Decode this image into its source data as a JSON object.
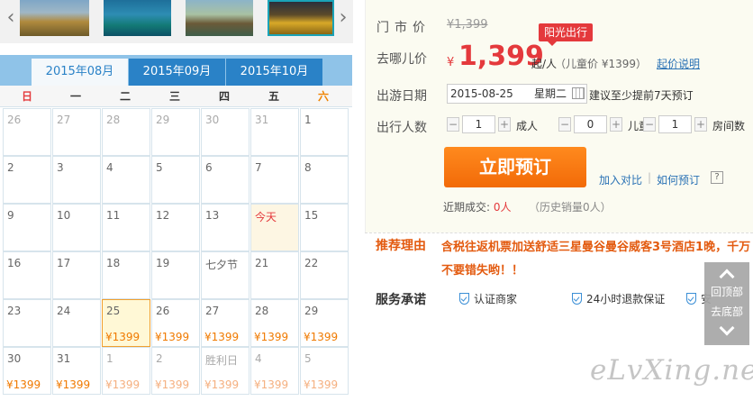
{
  "thumbnails": [
    "thumb-1",
    "thumb-2",
    "thumb-3",
    "thumb-4"
  ],
  "calendar": {
    "tabs": [
      {
        "label": "2015年08月",
        "active": true
      },
      {
        "label": "2015年09月",
        "active": false
      },
      {
        "label": "2015年10月",
        "active": false
      }
    ],
    "weekdays": [
      "日",
      "一",
      "二",
      "三",
      "四",
      "五",
      "六"
    ],
    "rows": [
      [
        {
          "d": "26",
          "m": true,
          "p": ""
        },
        {
          "d": "27",
          "m": true,
          "p": ""
        },
        {
          "d": "28",
          "m": true,
          "p": ""
        },
        {
          "d": "29",
          "m": true,
          "p": ""
        },
        {
          "d": "30",
          "m": true,
          "p": ""
        },
        {
          "d": "31",
          "m": true,
          "p": ""
        },
        {
          "d": "1",
          "m": false,
          "p": ""
        }
      ],
      [
        {
          "d": "2",
          "m": false,
          "p": ""
        },
        {
          "d": "3",
          "m": false,
          "p": ""
        },
        {
          "d": "4",
          "m": false,
          "p": ""
        },
        {
          "d": "5",
          "m": false,
          "p": ""
        },
        {
          "d": "6",
          "m": false,
          "p": ""
        },
        {
          "d": "7",
          "m": false,
          "p": ""
        },
        {
          "d": "8",
          "m": false,
          "p": ""
        }
      ],
      [
        {
          "d": "9",
          "m": false,
          "p": ""
        },
        {
          "d": "10",
          "m": false,
          "p": ""
        },
        {
          "d": "11",
          "m": false,
          "p": ""
        },
        {
          "d": "12",
          "m": false,
          "p": ""
        },
        {
          "d": "13",
          "m": false,
          "p": ""
        },
        {
          "d": "今天",
          "m": false,
          "p": "",
          "today": true
        },
        {
          "d": "15",
          "m": false,
          "p": ""
        }
      ],
      [
        {
          "d": "16",
          "m": false,
          "p": ""
        },
        {
          "d": "17",
          "m": false,
          "p": ""
        },
        {
          "d": "18",
          "m": false,
          "p": ""
        },
        {
          "d": "19",
          "m": false,
          "p": ""
        },
        {
          "d": "七夕节",
          "m": false,
          "p": ""
        },
        {
          "d": "21",
          "m": false,
          "p": ""
        },
        {
          "d": "22",
          "m": false,
          "p": ""
        }
      ],
      [
        {
          "d": "23",
          "m": false,
          "p": ""
        },
        {
          "d": "24",
          "m": false,
          "p": ""
        },
        {
          "d": "25",
          "m": false,
          "p": "¥1399",
          "selected": true
        },
        {
          "d": "26",
          "m": false,
          "p": "¥1399"
        },
        {
          "d": "27",
          "m": false,
          "p": "¥1399"
        },
        {
          "d": "28",
          "m": false,
          "p": "¥1399"
        },
        {
          "d": "29",
          "m": false,
          "p": "¥1399"
        }
      ],
      [
        {
          "d": "30",
          "m": false,
          "p": "¥1399"
        },
        {
          "d": "31",
          "m": false,
          "p": "¥1399"
        },
        {
          "d": "1",
          "m": true,
          "p": "¥1399"
        },
        {
          "d": "2",
          "m": true,
          "p": "¥1399"
        },
        {
          "d": "胜利日",
          "m": true,
          "p": "¥1399"
        },
        {
          "d": "4",
          "m": true,
          "p": "¥1399"
        },
        {
          "d": "5",
          "m": true,
          "p": "¥1399"
        }
      ]
    ]
  },
  "info": {
    "market_price_label": "门市价",
    "market_price": "¥1,399",
    "promo_tag": "阳光出行",
    "qunar_price_label": "去哪儿价",
    "currency": "¥",
    "price": "1,399",
    "per_person": "起/人",
    "child_price": "（儿童价 ¥1399）",
    "price_note_link": "起价说明",
    "date_label": "出游日期",
    "date_value": "2015-08-25",
    "date_weekday": "星期二",
    "date_note": "建议至少提前7天预订",
    "people_label": "出行人数",
    "adults": "1",
    "adults_unit": "成人",
    "children": "0",
    "children_unit": "儿童",
    "rooms": "1",
    "rooms_unit": "房间数",
    "minus": "−",
    "plus": "+",
    "book_button": "立即预订",
    "add_compare": "加入对比",
    "separator": "|",
    "how_to_book": "如何预订",
    "help": "?",
    "recent_deals_label": "近期成交:",
    "recent_deals_value": "0人",
    "history_sales": "（历史销量0人）"
  },
  "reason": {
    "label": "推荐理由",
    "text": "含税往返机票加送舒适三星曼谷曼谷威客3号酒店1晚，千万不要错失哟！！"
  },
  "service": {
    "label": "服务承诺",
    "items": [
      "认证商家",
      "24小时退款保证",
      "安"
    ]
  },
  "scroll_nav": {
    "top": "回顶部",
    "bottom": "去底部"
  },
  "watermark": "eLvXing.net",
  "colors": {
    "accent_blue": "#2a82c7",
    "price_red": "#e4393c",
    "button_orange": "#f26a08"
  }
}
